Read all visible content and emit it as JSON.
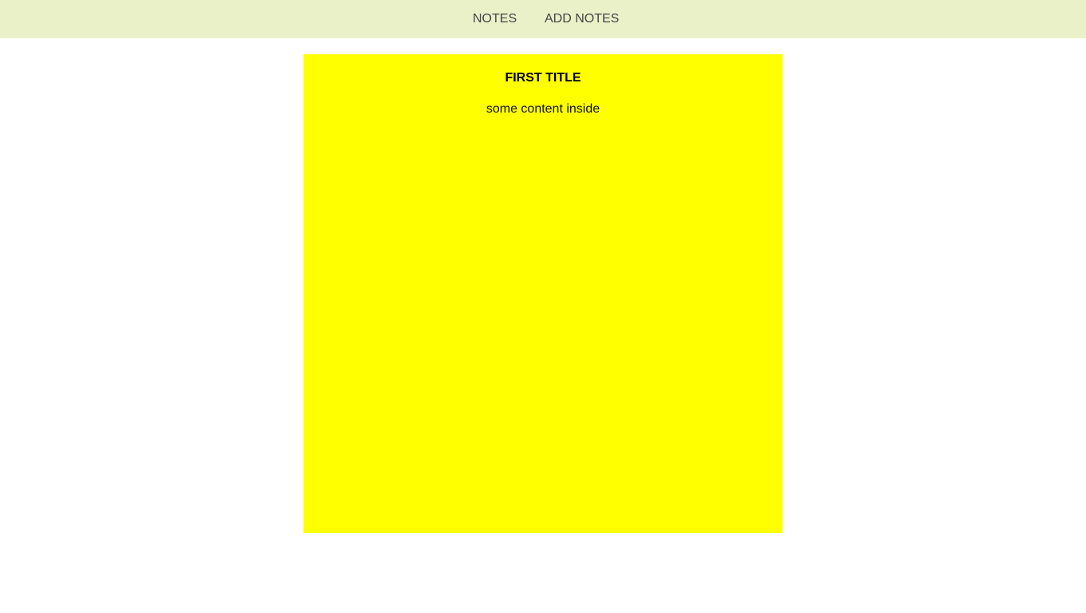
{
  "nav": {
    "items": [
      {
        "label": "NOTES"
      },
      {
        "label": "ADD NOTES"
      }
    ]
  },
  "note": {
    "title": "FIRST TITLE",
    "content": "some content inside"
  },
  "colors": {
    "topbar_bg": "#eaf1c8",
    "note_bg": "#ffff00",
    "page_bg": "#ffffff"
  }
}
